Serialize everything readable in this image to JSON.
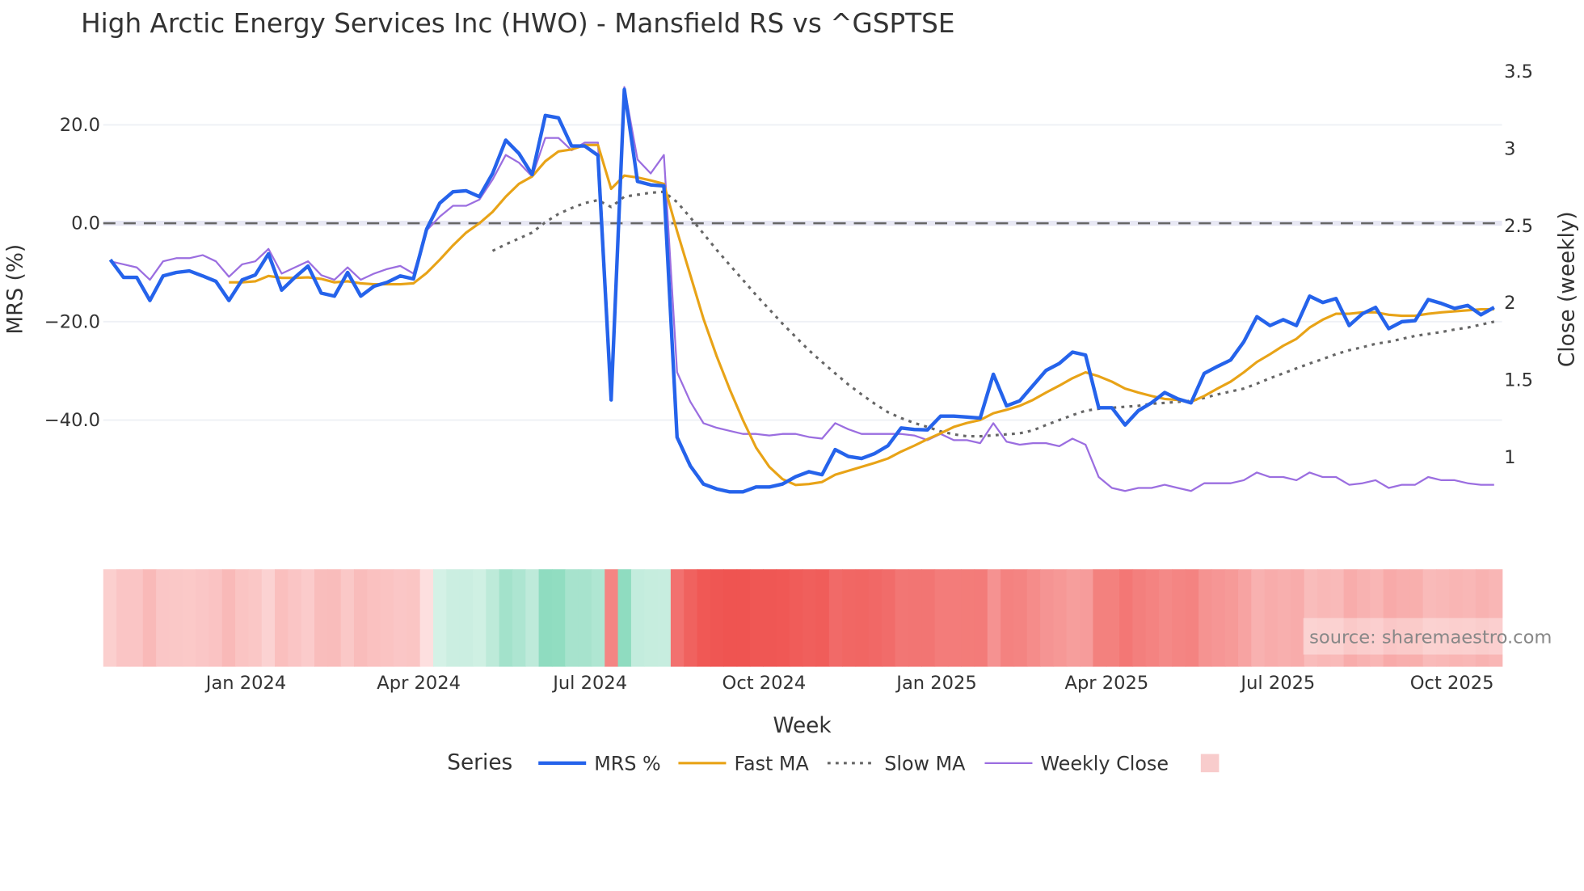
{
  "chart_data": {
    "type": "line",
    "title": "High Arctic Energy Services Inc (HWO) - Mansfield RS vs ^GSPTSE",
    "xlabel": "Week",
    "ylabel": "MRS (%)",
    "y2label": "Close (weekly)",
    "ylim": [
      -66,
      33
    ],
    "y2lim": [
      0.41,
      3.57
    ],
    "xlim": [
      -0.54,
      105.6
    ],
    "grid": true,
    "zero_line": 0,
    "yticks": [
      {
        "v": 20,
        "label": "20.0"
      },
      {
        "v": 0,
        "label": "0.0"
      },
      {
        "v": -20,
        "label": "−20.0"
      },
      {
        "v": -40,
        "label": "−40.0"
      }
    ],
    "y2ticks": [
      {
        "v": 3.5,
        "label": "3.5"
      },
      {
        "v": 3,
        "label": "3"
      },
      {
        "v": 2.5,
        "label": "2.5"
      },
      {
        "v": 2,
        "label": "2"
      },
      {
        "v": 1.5,
        "label": "1.5"
      },
      {
        "v": 1,
        "label": "1"
      }
    ],
    "xticks": [
      {
        "week": 10.3,
        "label": "Jan 2024"
      },
      {
        "week": 23.4,
        "label": "Apr 2024"
      },
      {
        "week": 36.4,
        "label": "Jul 2024"
      },
      {
        "week": 49.6,
        "label": "Oct 2024"
      },
      {
        "week": 62.7,
        "label": "Jan 2025"
      },
      {
        "week": 75.6,
        "label": "Apr 2025"
      },
      {
        "week": 88.6,
        "label": "Jul 2025"
      },
      {
        "week": 101.8,
        "label": "Oct 2025"
      }
    ],
    "legend": {
      "title": "Series",
      "placement": "bottom-center"
    },
    "series": [
      {
        "name": "MRS %",
        "axis": "left",
        "color": "#2563eb",
        "start": 0,
        "style": "solid",
        "width": 3.5,
        "values": [
          -7.4,
          -11,
          -11,
          -15.7,
          -10.7,
          -10,
          -9.7,
          -10.7,
          -11.8,
          -15.7,
          -11.5,
          -10.5,
          -6.2,
          -13.6,
          -11,
          -8.7,
          -14.2,
          -14.8,
          -10,
          -14.8,
          -12.8,
          -12,
          -10.7,
          -11.3,
          -1.2,
          4.1,
          6.4,
          6.6,
          5.4,
          10.1,
          16.9,
          14.2,
          9.9,
          21.9,
          21.4,
          15.7,
          15.7,
          13.8,
          -35.9,
          27.2,
          8.5,
          7.8,
          7.6,
          -43.5,
          -49.3,
          -53,
          -54,
          -54.6,
          -54.6,
          -53.6,
          -53.6,
          -53,
          -51.5,
          -50.5,
          -51.1,
          -46,
          -47.4,
          -47.8,
          -46.8,
          -45.2,
          -41.6,
          -41.9,
          -42,
          -39.2,
          -39.2,
          -39.4,
          -39.6,
          -30.7,
          -37.1,
          -36.1,
          -33,
          -29.9,
          -28.5,
          -26.2,
          -26.8,
          -37.5,
          -37.5,
          -41,
          -38.1,
          -36.5,
          -34.4,
          -35.7,
          -36.5,
          -30.5,
          -29.1,
          -27.8,
          -24.1,
          -19,
          -20.8,
          -19.6,
          -20.8,
          -14.8,
          -16.1,
          -15.3,
          -20.8,
          -18.4,
          -17.1,
          -21.4,
          -20,
          -19.8,
          -15.5,
          -16.3,
          -17.3,
          -16.7,
          -18.6,
          -17.1
        ]
      },
      {
        "name": "Fast MA",
        "axis": "left",
        "color": "#e8a317",
        "start": 9,
        "style": "solid",
        "width": 2.5,
        "values": [
          -12,
          -12,
          -11.8,
          -10.7,
          -11.1,
          -11.1,
          -11,
          -11.3,
          -12,
          -11.8,
          -12.2,
          -12.4,
          -12.4,
          -12.4,
          -12.2,
          -10.1,
          -7.4,
          -4.5,
          -1.9,
          0,
          2.3,
          5.4,
          8,
          9.5,
          12.6,
          14.6,
          15,
          15.9,
          15.9,
          7,
          9.7,
          9.3,
          8.7,
          8,
          -1.6,
          -10.5,
          -19.4,
          -27,
          -33.8,
          -40,
          -45.6,
          -49.5,
          -52,
          -53.2,
          -53,
          -52.6,
          -51.1,
          -50.3,
          -49.5,
          -48.7,
          -47.8,
          -46.4,
          -45.2,
          -43.9,
          -42.7,
          -41.4,
          -40.6,
          -40,
          -38.6,
          -37.9,
          -37.1,
          -35.9,
          -34.4,
          -33,
          -31.5,
          -30.3,
          -31.1,
          -32.2,
          -33.6,
          -34.4,
          -35.1,
          -35.7,
          -35.9,
          -36.3,
          -35.1,
          -33.6,
          -32.2,
          -30.3,
          -28.2,
          -26.6,
          -24.9,
          -23.5,
          -21.2,
          -19.6,
          -18.4,
          -18.4,
          -18.1,
          -18.1,
          -18.6,
          -18.8,
          -18.8,
          -18.4,
          -18.1,
          -17.9,
          -17.7,
          -17.5,
          -17.5
        ]
      },
      {
        "name": "Slow MA",
        "axis": "left",
        "color": "#666666",
        "start": 29,
        "style": "dot",
        "width": 2.5,
        "values": [
          -5.6,
          -4.3,
          -3.1,
          -1.9,
          0.2,
          1.9,
          3.1,
          4.1,
          4.7,
          3.3,
          5.4,
          5.8,
          6.2,
          6.4,
          4.3,
          1.2,
          -2.1,
          -5.4,
          -8.5,
          -11.5,
          -14.6,
          -17.5,
          -20.4,
          -23.1,
          -25.8,
          -28.2,
          -30.5,
          -32.8,
          -34.8,
          -36.7,
          -38.4,
          -39.6,
          -40.6,
          -41.4,
          -42.3,
          -42.9,
          -43.3,
          -43.3,
          -43.1,
          -42.9,
          -42.7,
          -42.1,
          -41,
          -40,
          -39,
          -38.1,
          -37.7,
          -37.5,
          -37.3,
          -37.1,
          -36.7,
          -36.5,
          -36.3,
          -36.1,
          -35.5,
          -34.8,
          -34.2,
          -33.6,
          -32.6,
          -31.5,
          -30.5,
          -29.5,
          -28.5,
          -27.6,
          -26.6,
          -25.8,
          -25.2,
          -24.5,
          -24.1,
          -23.5,
          -22.9,
          -22.5,
          -22.1,
          -21.6,
          -21.2,
          -20.6,
          -20
        ]
      },
      {
        "name": "Weekly Close",
        "axis": "right",
        "color": "#9b6ee0",
        "start": 0,
        "style": "solid",
        "width": 1.8,
        "values": [
          2.27,
          2.25,
          2.23,
          2.15,
          2.27,
          2.29,
          2.29,
          2.31,
          2.27,
          2.17,
          2.25,
          2.27,
          2.35,
          2.19,
          2.23,
          2.27,
          2.18,
          2.15,
          2.23,
          2.15,
          2.19,
          2.22,
          2.24,
          2.19,
          2.47,
          2.56,
          2.63,
          2.63,
          2.67,
          2.8,
          2.96,
          2.91,
          2.82,
          3.07,
          3.07,
          2.99,
          3.04,
          3.04,
          1.45,
          3.4,
          2.93,
          2.84,
          2.96,
          1.55,
          1.36,
          1.22,
          1.19,
          1.17,
          1.15,
          1.15,
          1.14,
          1.15,
          1.15,
          1.13,
          1.12,
          1.22,
          1.18,
          1.15,
          1.15,
          1.15,
          1.15,
          1.14,
          1.11,
          1.15,
          1.11,
          1.11,
          1.09,
          1.22,
          1.1,
          1.08,
          1.09,
          1.09,
          1.07,
          1.12,
          1.08,
          0.87,
          0.8,
          0.78,
          0.8,
          0.8,
          0.82,
          0.8,
          0.78,
          0.83,
          0.83,
          0.83,
          0.85,
          0.9,
          0.87,
          0.87,
          0.85,
          0.9,
          0.87,
          0.87,
          0.82,
          0.83,
          0.85,
          0.8,
          0.82,
          0.82,
          0.87,
          0.85,
          0.85,
          0.83,
          0.82,
          0.82
        ]
      }
    ],
    "heatmap": {
      "source_series": "MRS %",
      "negative_color": "#ef5350",
      "positive_color": "#8fdcc0",
      "legend_swatch_color": "#f8cccc"
    }
  },
  "watermark": "source: sharemaestro.com"
}
